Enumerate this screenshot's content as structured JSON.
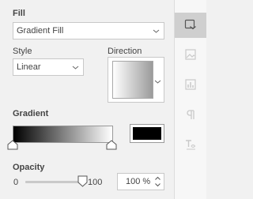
{
  "fill": {
    "label": "Fill",
    "selected": "Gradient Fill"
  },
  "style": {
    "label": "Style",
    "selected": "Linear"
  },
  "direction": {
    "label": "Direction"
  },
  "gradient": {
    "label": "Gradient",
    "start_color": "#000000",
    "end_color": "#ffffff",
    "stop_color": "#000000"
  },
  "opacity": {
    "label": "Opacity",
    "min": "0",
    "max": "100",
    "value": "100 %",
    "level": 1.0
  },
  "sidebar": {
    "icons": [
      {
        "name": "shape-settings-icon",
        "active": true
      },
      {
        "name": "image-settings-icon",
        "active": false
      },
      {
        "name": "chart-settings-icon",
        "active": false
      },
      {
        "name": "paragraph-settings-icon",
        "active": false
      },
      {
        "name": "text-art-settings-icon",
        "active": false
      }
    ]
  }
}
